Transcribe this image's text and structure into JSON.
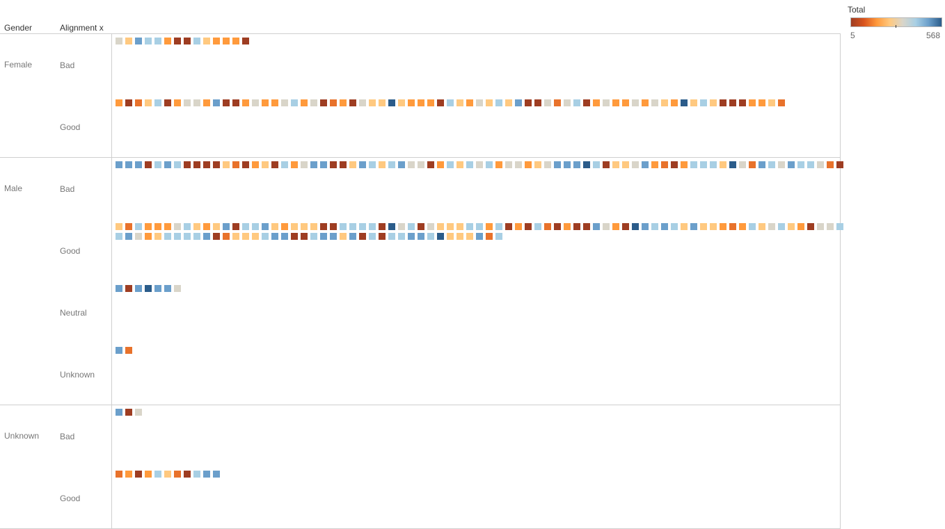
{
  "headers": {
    "gender": "Gender",
    "alignment": "Alignment x"
  },
  "legend": {
    "title": "Total",
    "min": "5",
    "max": "568",
    "gradient": [
      "#9e3d22",
      "#d9541e",
      "#ff9a3c",
      "#ffc980",
      "#d9d5c9",
      "#a8cfe4",
      "#6b9fcb",
      "#2b5c8a"
    ]
  },
  "chart_data": {
    "type": "heatmap",
    "color_field": "Total",
    "color_range": [
      5,
      568
    ],
    "rows": [
      {
        "gender": "Female",
        "alignment": "Bad",
        "marks": [
          4,
          3,
          1,
          2,
          2,
          5,
          0,
          0,
          2,
          3,
          5,
          5,
          5,
          0
        ]
      },
      {
        "gender": "Female",
        "alignment": "Good",
        "marks": [
          5,
          0,
          6,
          3,
          2,
          0,
          5,
          4,
          4,
          5,
          1,
          0,
          0,
          5,
          4,
          5,
          5,
          4,
          2,
          5,
          4,
          0,
          6,
          5,
          0,
          4,
          3,
          3,
          1,
          3,
          5,
          5,
          5,
          0,
          2,
          3,
          5,
          4,
          3,
          2,
          3,
          1,
          0,
          0,
          4,
          6,
          4,
          2,
          0,
          5,
          4,
          5,
          5,
          4,
          5,
          4,
          3,
          5,
          1,
          3,
          2,
          3,
          0,
          0,
          0,
          5,
          5,
          3,
          6
        ]
      },
      {
        "gender": "Male",
        "alignment": "Bad",
        "marks": [
          1,
          1,
          1,
          0,
          2,
          1,
          2,
          0,
          0,
          0,
          0,
          3,
          6,
          0,
          5,
          3,
          0,
          2,
          5,
          4,
          1,
          1,
          0,
          0,
          3,
          1,
          2,
          3,
          2,
          1,
          4,
          4,
          0,
          5,
          2,
          3,
          2,
          4,
          2,
          5,
          4,
          4,
          5,
          3,
          4,
          1,
          1,
          1,
          1,
          2,
          0,
          3,
          3,
          4,
          1,
          5,
          6,
          0,
          5,
          2,
          2,
          2,
          3,
          1,
          4,
          6,
          1,
          2,
          4,
          1,
          2,
          2,
          4,
          6,
          0
        ]
      },
      {
        "gender": "Male",
        "alignment": "Good",
        "marks": [
          3,
          6,
          2,
          5,
          5,
          5,
          4,
          2,
          3,
          5,
          3,
          1,
          0,
          2,
          2,
          1,
          3,
          5,
          3,
          3,
          3,
          0,
          0,
          2,
          2,
          2,
          2,
          0,
          1,
          4,
          2,
          0,
          4,
          3,
          3,
          3,
          2,
          2,
          5,
          2,
          0,
          5,
          0,
          2,
          6,
          0,
          5,
          0,
          0,
          1,
          4,
          5,
          0,
          1,
          1,
          2,
          1,
          2,
          3,
          1,
          3,
          3,
          5,
          6,
          5,
          2,
          3,
          4,
          2,
          3,
          5,
          0,
          4,
          4,
          2,
          2,
          1,
          4,
          5,
          3,
          2,
          2,
          2,
          2,
          1,
          0,
          6,
          3,
          3,
          3,
          2,
          1,
          1,
          0,
          0,
          2,
          1,
          1,
          3,
          1,
          0,
          2,
          0,
          2,
          2,
          1,
          1,
          2,
          1,
          3,
          3,
          3,
          1,
          6,
          2
        ]
      },
      {
        "gender": "Male",
        "alignment": "Neutral",
        "marks": [
          1,
          0,
          1,
          1,
          1,
          1,
          4
        ]
      },
      {
        "gender": "Male",
        "alignment": "Unknown",
        "marks": [
          1,
          6
        ]
      },
      {
        "gender": "Unknown",
        "alignment": "Bad",
        "marks": [
          1,
          0,
          4
        ]
      },
      {
        "gender": "Unknown",
        "alignment": "Good",
        "marks": [
          6,
          5,
          0,
          5,
          2,
          3,
          6,
          0,
          2,
          1,
          1
        ]
      }
    ]
  }
}
